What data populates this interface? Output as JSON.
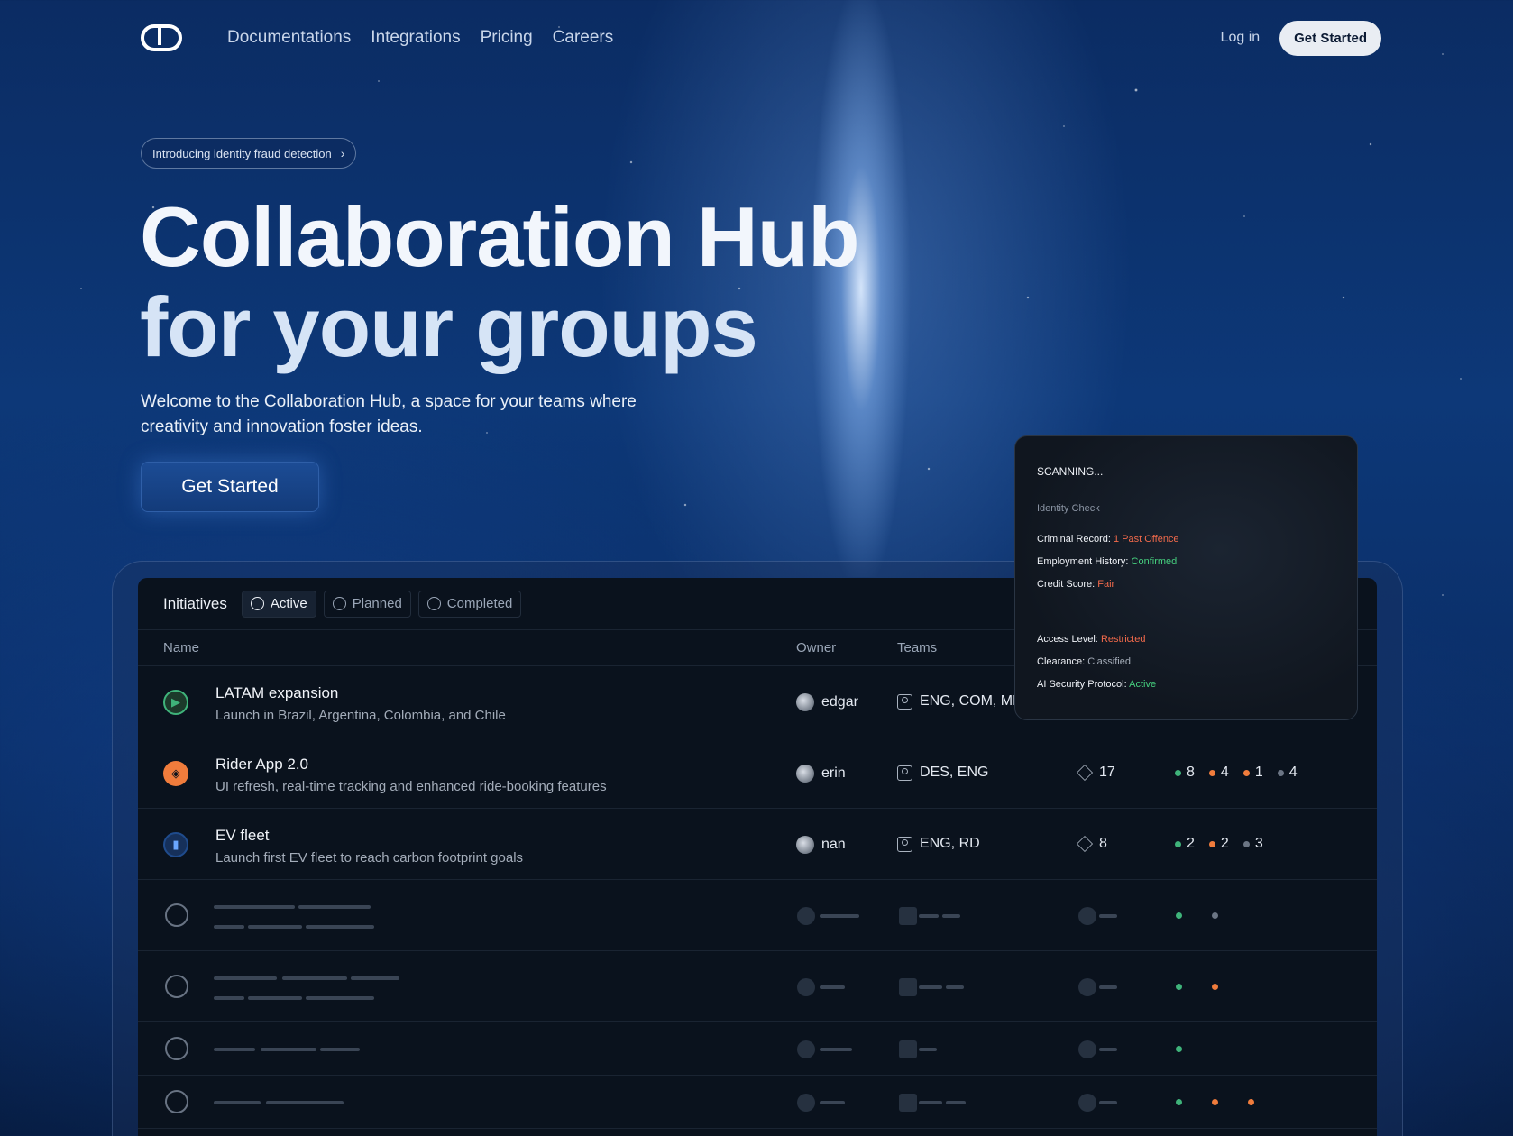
{
  "nav": {
    "links": [
      "Documentations",
      "Integrations",
      "Pricing",
      "Careers"
    ],
    "login": "Log in",
    "cta": "Get Started"
  },
  "hero": {
    "announcement": "Introducing identity fraud detection",
    "title_line1": "Collaboration Hub",
    "title_line2": "for your groups",
    "subtitle": "Welcome to the Collaboration Hub, a space for your teams where creativity and innovation foster ideas.",
    "cta": "Get Started"
  },
  "panel": {
    "heading": "Initiatives",
    "tabs": [
      "Active",
      "Planned",
      "Completed"
    ],
    "columns": {
      "name": "Name",
      "owner": "Owner",
      "teams": "Teams"
    },
    "rows": [
      {
        "name": "LATAM expansion",
        "desc": "Launch in Brazil, Argentina, Colombia, and Chile",
        "owner": "edgar",
        "teams": "ENG, COM, MK",
        "count": "",
        "status_color": "#3fb37a",
        "stats": []
      },
      {
        "name": "Rider App 2.0",
        "desc": "UI refresh, real-time tracking and enhanced ride-booking features",
        "owner": "erin",
        "teams": "DES, ENG",
        "count": "17",
        "status_color": "#f07c3c",
        "stats": [
          {
            "c": "green",
            "v": "8"
          },
          {
            "c": "orange",
            "v": "4"
          },
          {
            "c": "orange",
            "v": "1"
          },
          {
            "c": "gray",
            "v": "4"
          }
        ]
      },
      {
        "name": "EV fleet",
        "desc": "Launch first EV fleet to reach carbon footprint goals",
        "owner": "nan",
        "teams": "ENG, RD",
        "count": "8",
        "status_color": "#3b82f6",
        "stats": [
          {
            "c": "green",
            "v": "2"
          },
          {
            "c": "orange",
            "v": "2"
          },
          {
            "c": "gray",
            "v": "3"
          }
        ]
      }
    ]
  },
  "scan": {
    "status": "SCANNING...",
    "section": "Identity Check",
    "criminal_label": "Criminal Record:",
    "criminal_value": "1 Past Offence",
    "employment_label": "Employment History:",
    "employment_value": "Confirmed",
    "credit_label": "Credit Score:",
    "credit_value": "Fair",
    "access_label": "Access Level:",
    "access_value": "Restricted",
    "clearance_label": "Clearance:",
    "clearance_value": "Classified",
    "protocol_label": "AI Security Protocol:",
    "protocol_value": "Active"
  }
}
